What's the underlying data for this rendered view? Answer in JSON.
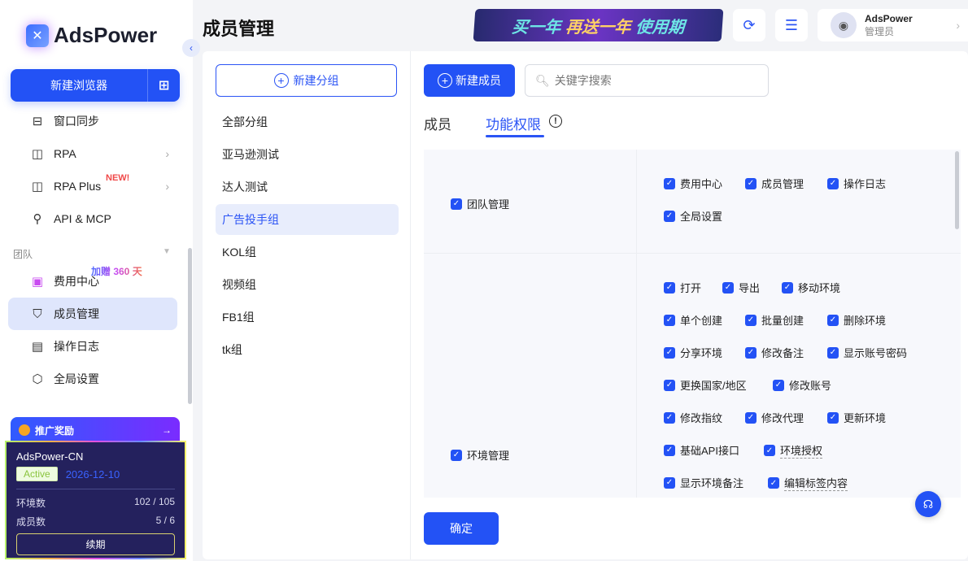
{
  "sidebar": {
    "logo": "AdsPower",
    "new_browser": "新建浏览器",
    "items": [
      {
        "label": "窗口同步",
        "icon": "window-sync-icon"
      },
      {
        "label": "RPA",
        "icon": "robot-icon"
      },
      {
        "label": "RPA Plus",
        "icon": "robot-plus-icon"
      },
      {
        "label": "API & MCP",
        "icon": "plug-icon"
      }
    ],
    "new_badge": "NEW!",
    "section": "团队",
    "bonus": "加赠 360 天",
    "team_items": [
      {
        "label": "费用中心",
        "icon": "wallet-icon"
      },
      {
        "label": "成员管理",
        "icon": "member-icon"
      },
      {
        "label": "操作日志",
        "icon": "log-icon"
      },
      {
        "label": "全局设置",
        "icon": "settings-icon"
      }
    ],
    "promo": "推广奖励",
    "plan": {
      "name": "AdsPower-CN",
      "status": "Active",
      "date": "2026-12-10",
      "env_label": "环境数",
      "env_value": "102 / 105",
      "member_label": "成员数",
      "member_value": "5 / 6",
      "renew": "续期"
    }
  },
  "header": {
    "title": "成员管理",
    "banner_a": "买一年",
    "banner_b": "再送一年",
    "banner_c": "使用期",
    "user_name": "AdsPower",
    "user_role": "管理员"
  },
  "groups": {
    "new_group": "新建分组",
    "items": [
      "全部分组",
      "亚马逊测试",
      "达人测试",
      "广告投手组",
      "KOL组",
      "视频组",
      "FB1组",
      "tk组"
    ],
    "selected": 3
  },
  "members": {
    "new_member": "新建成员",
    "search_placeholder": "关键字搜索",
    "tabs": [
      "成员",
      "功能权限"
    ],
    "active_tab": 1,
    "confirm": "确定"
  },
  "permissions": [
    {
      "category": "团队管理",
      "rows": [
        [
          "费用中心",
          "成员管理",
          "操作日志"
        ],
        [
          "全局设置"
        ]
      ]
    },
    {
      "category": "环境管理",
      "rows": [
        [
          "打开",
          "导出",
          "移动环境"
        ],
        [
          "单个创建",
          "批量创建",
          "删除环境"
        ],
        [
          "分享环境",
          "修改备注",
          "显示账号密码"
        ],
        [
          "更换国家/地区",
          "修改账号"
        ],
        [
          "修改指纹",
          "修改代理",
          "更新环境"
        ],
        [
          "基础API接口",
          "环境授权"
        ],
        [
          "显示环境备注",
          "编辑标签内容"
        ]
      ],
      "dashed": [
        "环境授权",
        "编辑标签内容"
      ]
    }
  ],
  "colors": {
    "primary": "#2352f5",
    "selected_bg": "#e8edfc"
  }
}
